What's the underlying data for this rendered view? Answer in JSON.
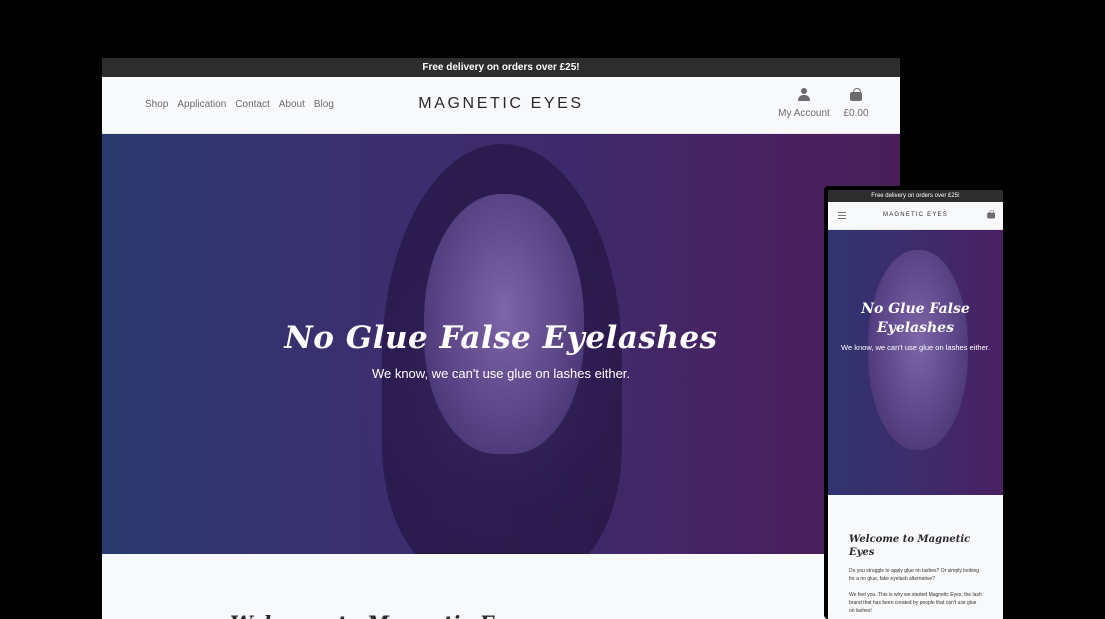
{
  "desktop": {
    "banner": "Free delivery on orders over £25!",
    "nav": [
      "Shop",
      "Application",
      "Contact",
      "About",
      "Blog"
    ],
    "logo": "MAGNETIC EYES",
    "account_label": "My Account",
    "cart_total": "£0.00",
    "hero_title": "No Glue False Eyelashes",
    "hero_subtitle": "We know, we can't use glue on lashes either.",
    "welcome_heading": "Welcome to Magnetic Eyes"
  },
  "mobile": {
    "banner": "Free delivery on orders over £25!",
    "logo": "MAGNETIC EYES",
    "hero_title": "No Glue False Eyelashes",
    "hero_subtitle": "We know, we can't use glue on lashes either.",
    "welcome_heading": "Welcome to Magnetic Eyes",
    "paragraph_1": "Do you struggle to apply glue on lashes? Or simply looking for a no glue, fake eyelash alternative?",
    "paragraph_2": "We feel you. This is why we started Magnetic Eyes, the lash brand that has been created by people that can't use glue on lashes!"
  },
  "icons": {
    "account": "person-icon",
    "cart": "shopping-bag-icon",
    "menu": "hamburger-menu-icon"
  },
  "colors": {
    "banner_bg": "#2d2d2d",
    "hero_tint": "#3e2a6a",
    "page_bg": "#f8f9fb"
  }
}
